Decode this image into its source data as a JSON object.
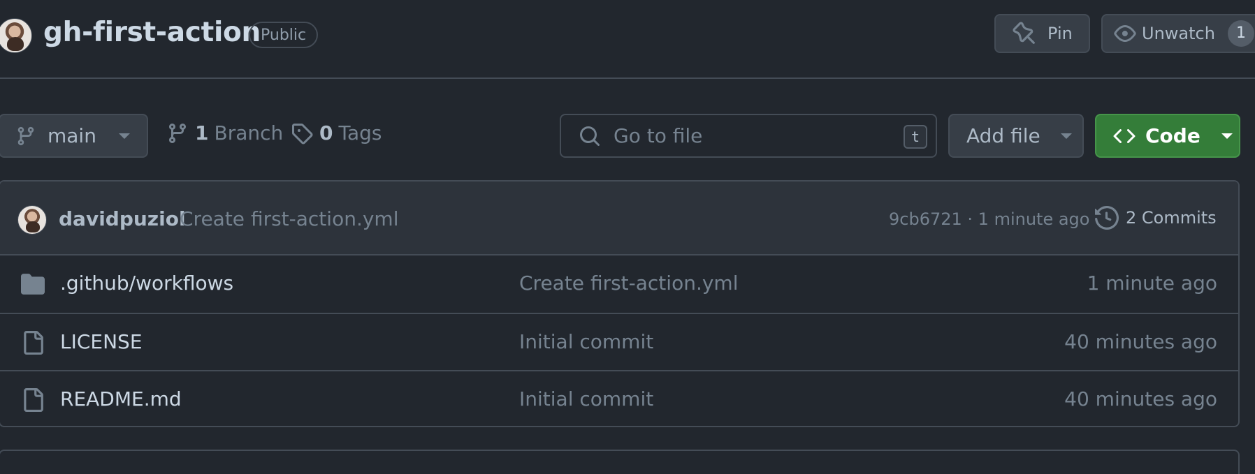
{
  "repo": {
    "name": "gh-first-action",
    "visibility": "Public"
  },
  "header_actions": {
    "pin_label": "Pin",
    "watch_label": "Unwatch",
    "watch_count": "1"
  },
  "toolbar": {
    "branch": "main",
    "branch_count": "1",
    "branch_label": "Branch",
    "tag_count": "0",
    "tag_label": "Tags",
    "search_placeholder": "Go to file",
    "search_shortcut": "t",
    "add_file_label": "Add file",
    "code_label": "Code"
  },
  "latest_commit": {
    "author": "davidpuziol",
    "message": "Create first-action.yml",
    "meta": "9cb6721 · 1 minute ago",
    "commits_label": "2 Commits"
  },
  "files": [
    {
      "type": "folder",
      "name": ".github/workflows",
      "message": "Create first-action.yml",
      "age": "1 minute ago"
    },
    {
      "type": "file",
      "name": "LICENSE",
      "message": "Initial commit",
      "age": "40 minutes ago"
    },
    {
      "type": "file",
      "name": "README.md",
      "message": "Initial commit",
      "age": "40 minutes ago"
    }
  ],
  "icons": {
    "branch": "git-branch-icon",
    "tag": "tag-icon",
    "search": "search-icon",
    "code": "code-icon",
    "history": "history-icon",
    "folder": "folder-icon",
    "file": "file-icon",
    "pin": "pin-icon",
    "eye": "eye-icon"
  },
  "colors": {
    "background": "#22272e",
    "border": "#444c56",
    "button_bg": "#373e47",
    "primary_green": "#347d39",
    "muted_text": "#768390"
  }
}
